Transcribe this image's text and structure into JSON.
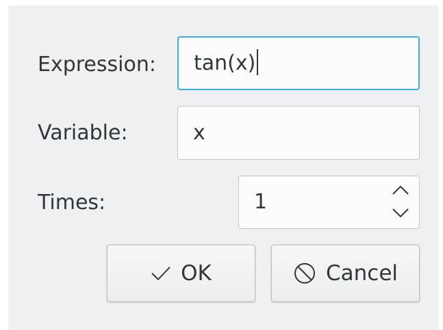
{
  "form": {
    "expression": {
      "label": "Expression:",
      "value": "tan(x)"
    },
    "variable": {
      "label": "Variable:",
      "value": "x"
    },
    "times": {
      "label": "Times:",
      "value": "1"
    }
  },
  "buttons": {
    "ok_label": "OK",
    "ok_icon": "checkmark-icon",
    "cancel_label": "Cancel",
    "cancel_icon": "cancel-circle-icon"
  },
  "colors": {
    "dialog_background": "#eff0f1",
    "focus_accent": "#3daee9",
    "text": "#31363b"
  }
}
